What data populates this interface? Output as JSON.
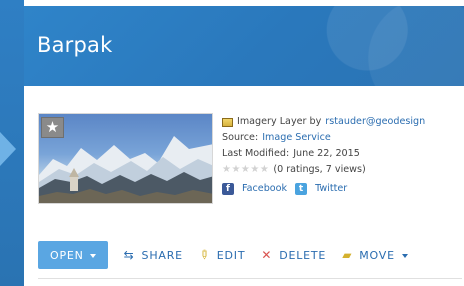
{
  "header": {
    "title": "Barpak"
  },
  "thumbnail": {
    "favorite_icon": "star-icon"
  },
  "details": {
    "type_prefix": "Imagery Layer by",
    "owner": "rstauder@geodesign",
    "source_label": "Source:",
    "source_value": "Image Service",
    "modified_label": "Last Modified:",
    "modified_value": "June 22, 2015",
    "rating_text": "(0 ratings, 7 views)",
    "social": {
      "facebook": "Facebook",
      "twitter": "Twitter"
    }
  },
  "actions": {
    "open": "OPEN",
    "share": "SHARE",
    "edit": "EDIT",
    "delete": "DELETE",
    "move": "MOVE"
  },
  "colors": {
    "accent": "#2f84c9",
    "link": "#2b6db0",
    "primary_button": "#5aa6e2",
    "delete": "#d9534f"
  }
}
